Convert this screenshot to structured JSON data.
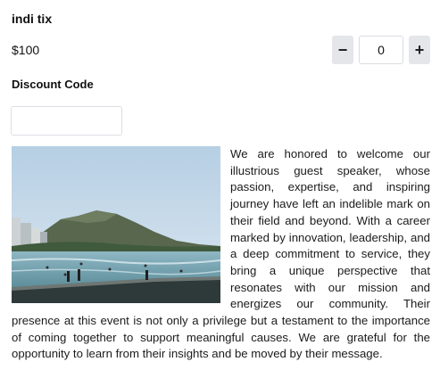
{
  "ticket": {
    "name": "indi tix",
    "price": "$100",
    "quantity": "0",
    "decrement_label": "−",
    "increment_label": "+"
  },
  "discount": {
    "label": "Discount Code",
    "value": "",
    "placeholder": ""
  },
  "description": {
    "image_icon": "beach-photo",
    "text": "We are honored to welcome our illustrious guest speaker, whose passion, expertise, and inspiring journey have left an indelible mark on their field and beyond. With a career marked by innovation, leadership, and a deep commitment to service, they bring a unique perspective that resonates with our mission and energizes our community. Their presence at this event is not only a privilege but a testament to the importance of coming together to support meaningful causes. We are grateful for the opportunity to learn from their insights and be moved by their message."
  },
  "colors": {
    "stepper_button_bg": "#e4e6ea",
    "border": "#dcdfe4",
    "text": "#1b1b1b"
  }
}
